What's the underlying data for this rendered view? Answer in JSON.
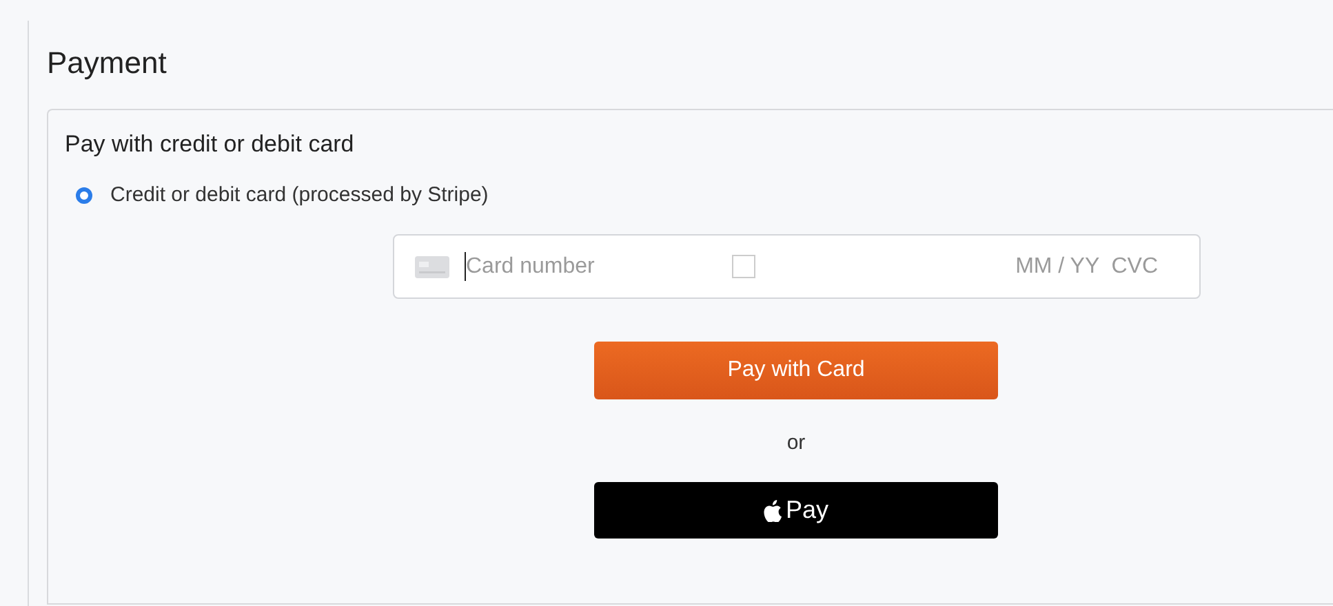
{
  "title": "Payment",
  "section": {
    "heading": "Pay with credit or debit card",
    "options": [
      {
        "label": "Credit or debit card (processed by Stripe)",
        "selected": true
      }
    ],
    "card_field": {
      "number": {
        "placeholder": "Card number"
      },
      "expiry_cvc": {
        "placeholder": "MM / YY  CVC"
      }
    },
    "pay_button": "Pay with Card",
    "separator": "or",
    "wallet_button": "Pay"
  }
}
